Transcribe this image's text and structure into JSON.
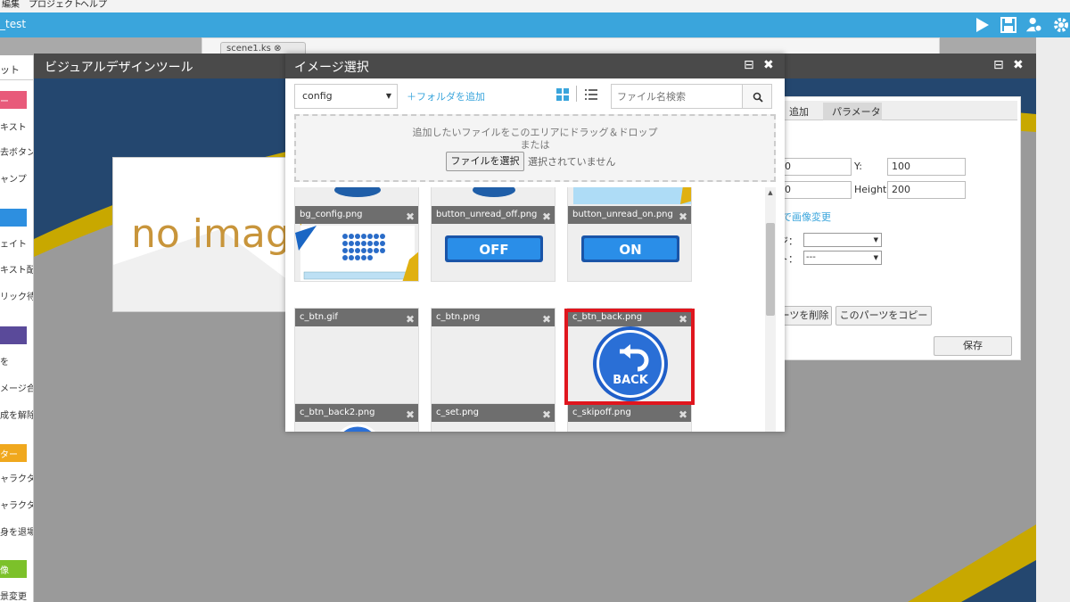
{
  "menubar": {
    "items": [
      "編集",
      "プロジェクト",
      "ヘルプ"
    ]
  },
  "titlebar": {
    "project": "_test",
    "icons": [
      "play-icon",
      "save-icon",
      "users-gear-icon",
      "gear-icon"
    ]
  },
  "scenebar": {
    "tab_label": "scene1.ks"
  },
  "palette": {
    "tab": "ット",
    "sections": [
      {
        "label": "ー",
        "color": "#e85a7a",
        "items": [
          "キスト",
          "去ボタン",
          "ャンプ"
        ]
      },
      {
        "label": "",
        "color": "#2d8fe0",
        "items": [
          "ェイト",
          "キスト配置",
          "リック待ち"
        ]
      },
      {
        "label": "",
        "color": "#5a4a9a",
        "items": [
          "を",
          "メージ合成",
          "成を解除"
        ]
      },
      {
        "label": "ター",
        "color": "#f0a81e",
        "items": [
          "ャラクター",
          "ャラクター",
          "身を退場"
        ]
      },
      {
        "label": "像",
        "color": "#7cc12a",
        "items": [
          "景変更"
        ]
      }
    ]
  },
  "vdt": {
    "title": "ビジュアルデザインツール",
    "noimage": "no image"
  },
  "props": {
    "tabs": [
      "追加",
      "パラメータ"
    ],
    "x_value": "0",
    "y_label": "Y:",
    "y_value": "100",
    "w_value": "0",
    "height_label": "Height:",
    "height_value": "200",
    "change_image": "で画像変更",
    "label1": "ジ：",
    "label2": "ト：",
    "select2": "---",
    "delete_btn": "ーツを削除",
    "copy_btn": "このパーツをコピー",
    "save_btn": "保存"
  },
  "dialog": {
    "title": "イメージ選択",
    "folder": "config",
    "add_folder": "＋フォルダを追加",
    "search_placeholder": "ファイル名検索",
    "drop_text": "追加したいファイルをこのエリアにドラッグ＆ドロップ",
    "drop_or": "または",
    "file_button": "ファイルを選択",
    "file_none": "選択されていません",
    "tiles": [
      "bg_config.png",
      "button_unread_off.png",
      "button_unread_on.png",
      "c_btn.gif",
      "c_btn.png",
      "c_btn_back.png",
      "c_btn_back2.png",
      "c_set.png",
      "c_skipoff.png"
    ],
    "off_label": "OFF",
    "on_label": "ON",
    "back_label": "BACK"
  }
}
